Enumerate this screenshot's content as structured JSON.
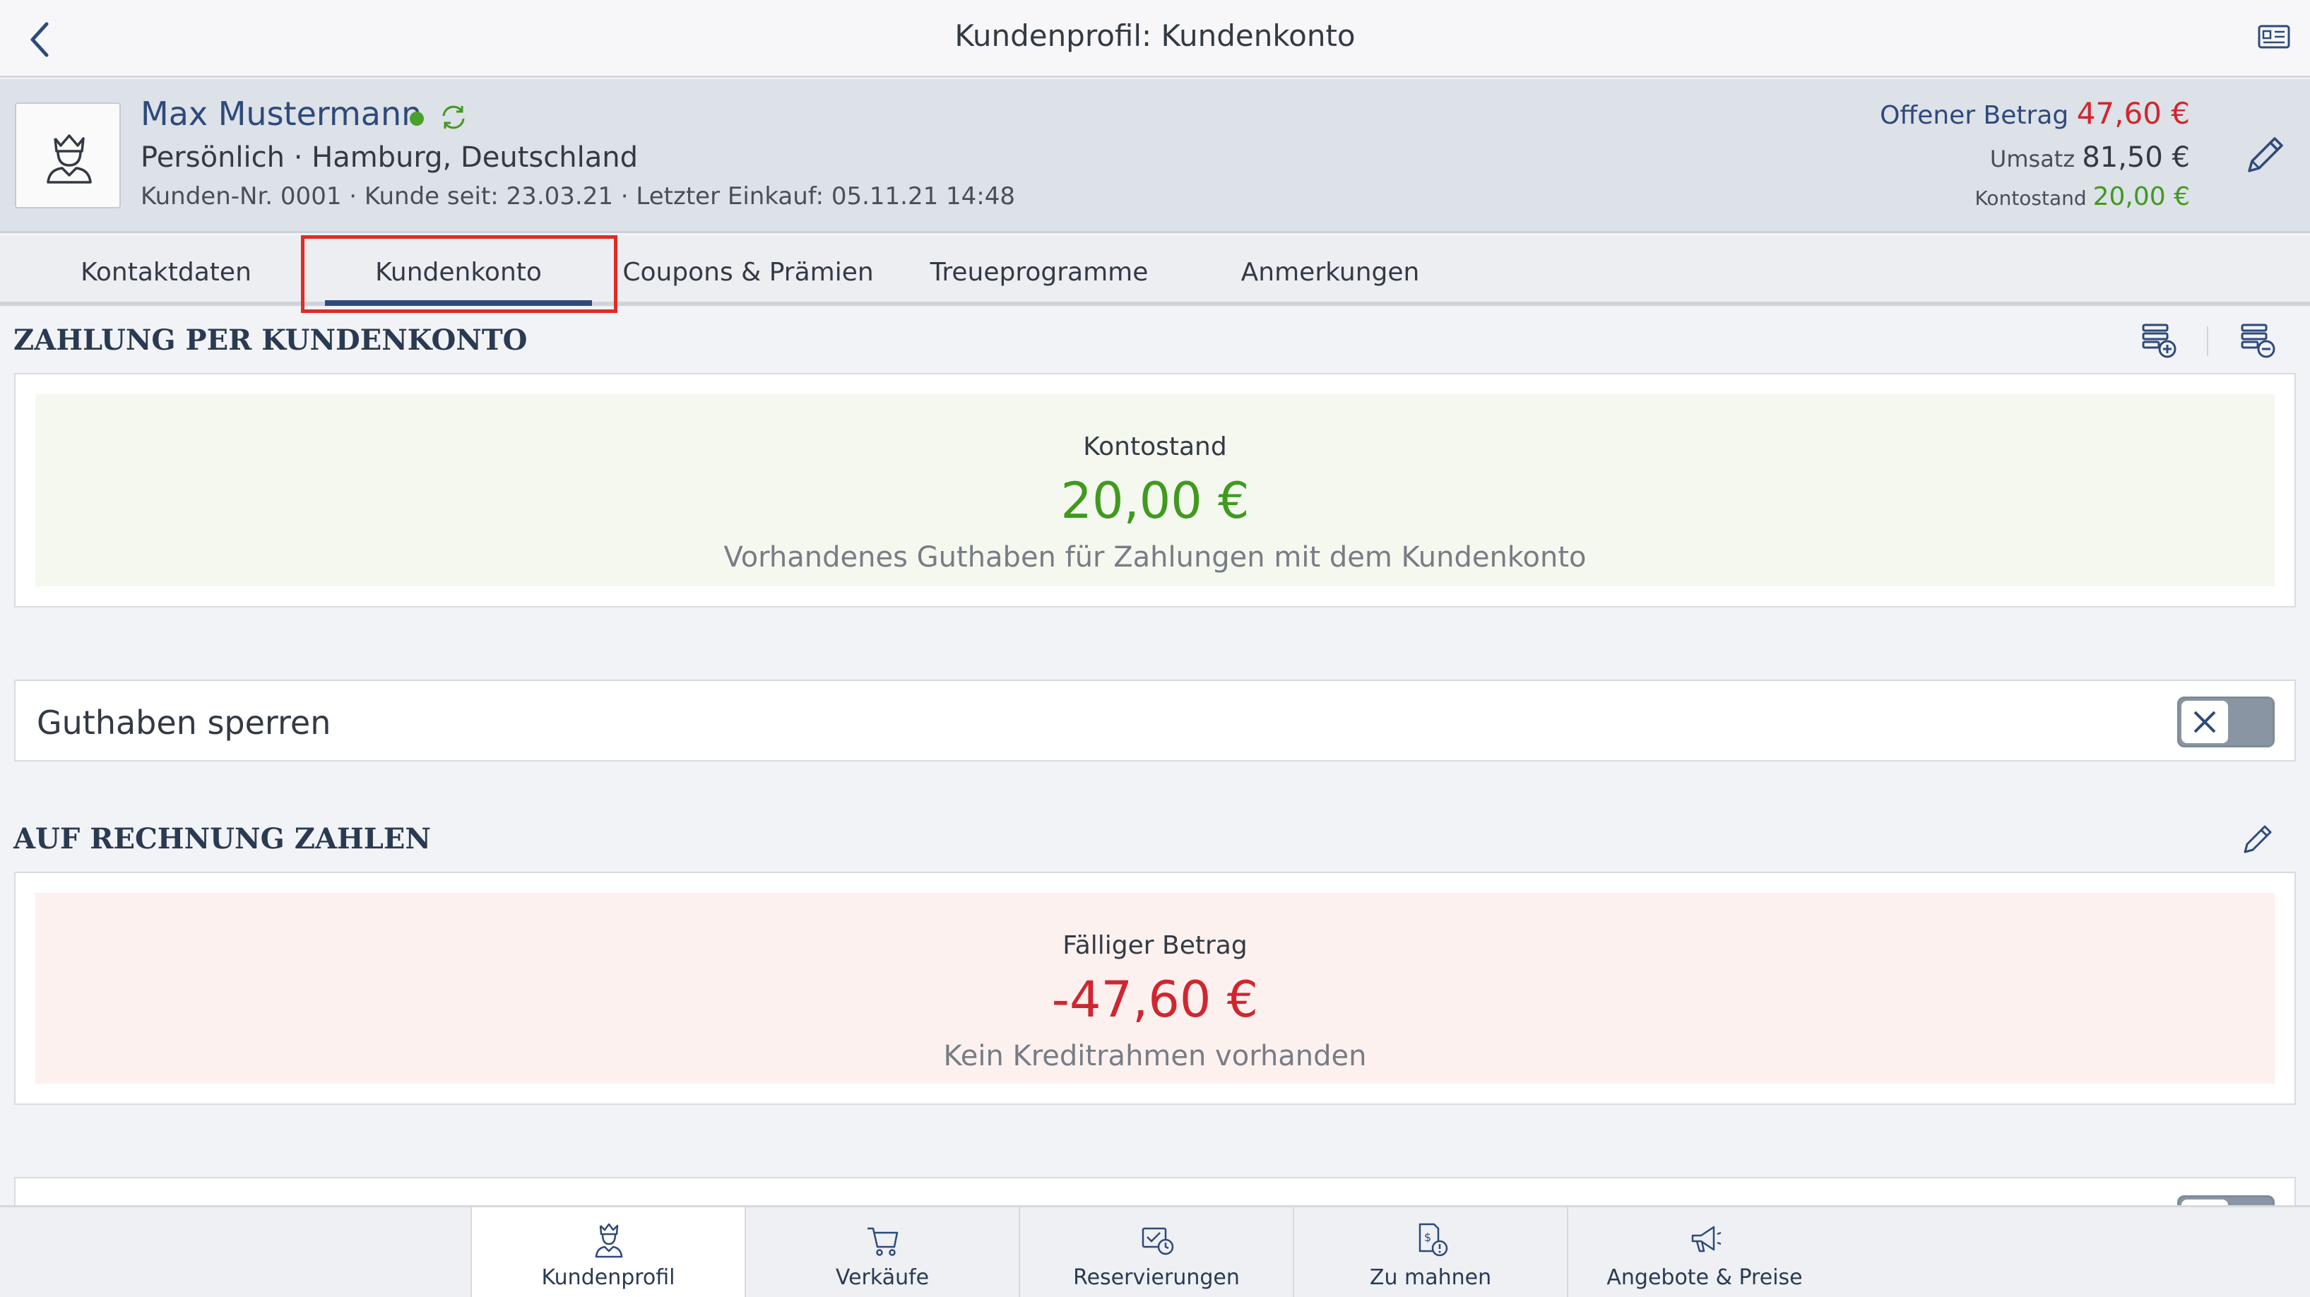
{
  "topbar": {
    "title": "Kundenprofil: Kundenkonto"
  },
  "customer": {
    "name": "Max Mustermann",
    "subtitle": "Persönlich · Hamburg, Deutschland",
    "meta": "Kunden-Nr. 0001 · Kunde seit: 23.03.21 · Letzter Einkauf: 05.11.21 14:48"
  },
  "summary": {
    "open_label": "Offener Betrag",
    "open_value": "47,60 €",
    "sales_label": "Umsatz",
    "sales_value": "81,50 €",
    "balance_label": "Kontostand",
    "balance_value": "20,00 €"
  },
  "tabs": [
    {
      "label": "Kontaktdaten"
    },
    {
      "label": "Kundenkonto"
    },
    {
      "label": "Coupons & Prämien"
    },
    {
      "label": "Treueprogramme"
    },
    {
      "label": "Anmerkungen"
    }
  ],
  "account_section": {
    "title": "ZAHLUNG PER KUNDENKONTO",
    "caption": "Kontostand",
    "amount": "20,00 €",
    "note": "Vorhandenes Guthaben für Zahlungen mit dem Kundenkonto"
  },
  "lock_credit": {
    "label": "Guthaben sperren",
    "enabled": false
  },
  "invoice_section": {
    "title": "AUF RECHNUNG ZAHLEN",
    "caption": "Fälliger Betrag",
    "amount": "-47,60 €",
    "note": "Kein Kreditrahmen vorhanden"
  },
  "bottomnav": [
    {
      "label": "Kundenprofil",
      "icon": "customer-icon"
    },
    {
      "label": "Verkäufe",
      "icon": "cart-icon"
    },
    {
      "label": "Reservierungen",
      "icon": "reservation-icon"
    },
    {
      "label": "Zu mahnen",
      "icon": "reminder-icon"
    },
    {
      "label": "Angebote & Preise",
      "icon": "megaphone-icon"
    }
  ],
  "colors": {
    "accent": "#2d4a7a",
    "positive": "#3f9a1e",
    "negative": "#d0262f",
    "highlight": "#e02b24"
  }
}
